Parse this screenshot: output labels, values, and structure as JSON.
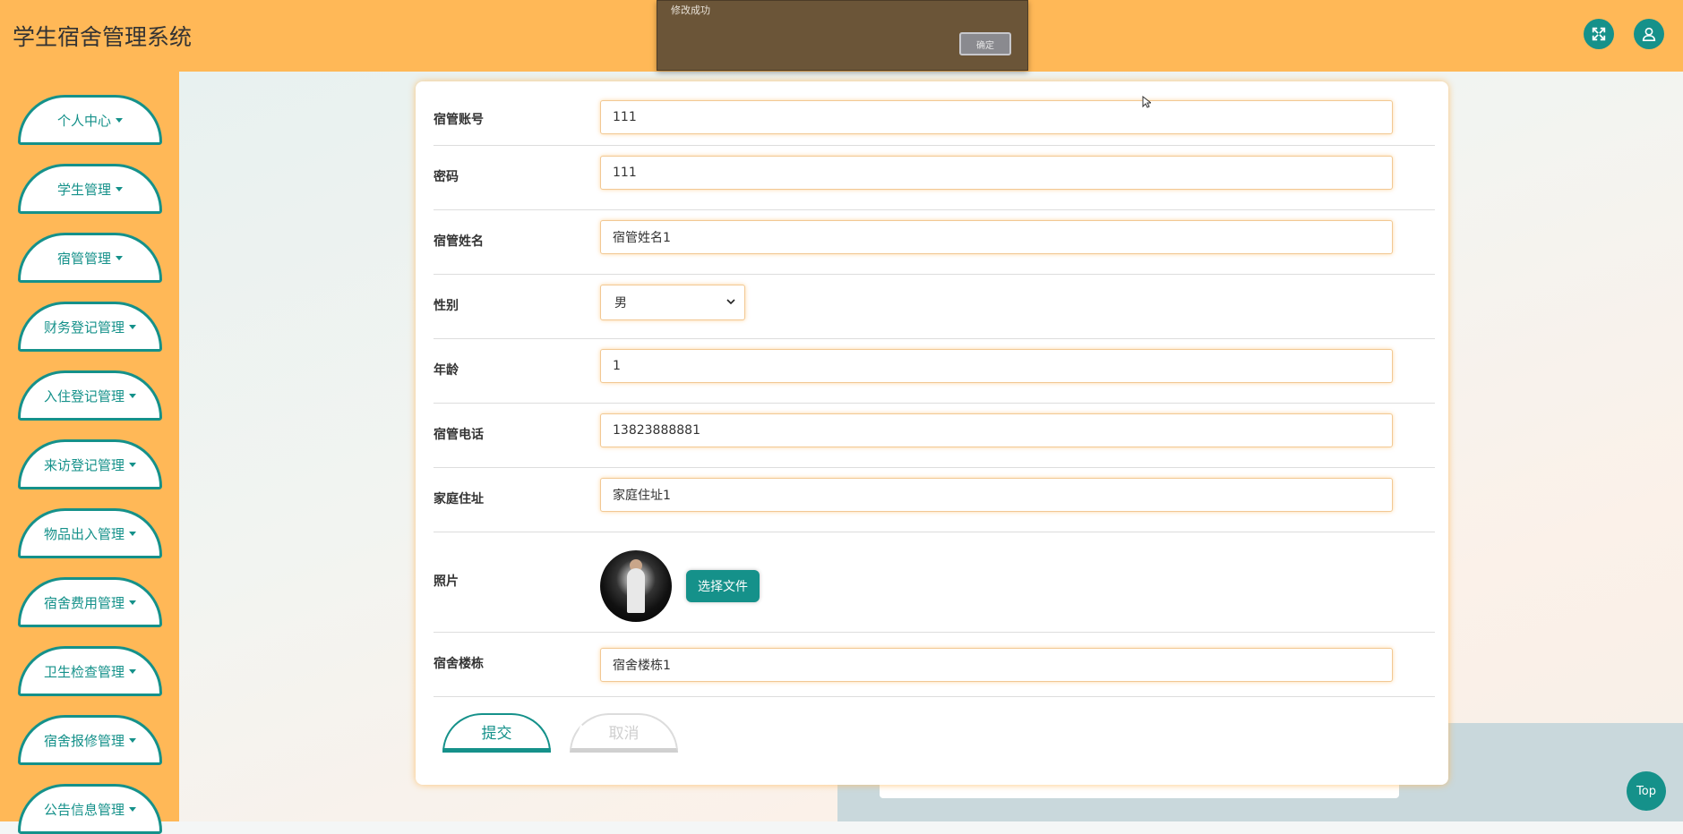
{
  "header": {
    "title": "学生宿舍管理系统",
    "fullscreen_icon": "expand-icon",
    "user_icon": "user-icon",
    "accent": "#ffb857",
    "primary": "#15918a"
  },
  "toast": {
    "message": "修改成功",
    "confirm_label": "确定"
  },
  "sidebar": {
    "items": [
      {
        "label": "个人中心"
      },
      {
        "label": "学生管理"
      },
      {
        "label": "宿管管理"
      },
      {
        "label": "财务登记管理"
      },
      {
        "label": "入住登记管理"
      },
      {
        "label": "来访登记管理"
      },
      {
        "label": "物品出入管理"
      },
      {
        "label": "宿舍费用管理"
      },
      {
        "label": "卫生检查管理"
      },
      {
        "label": "宿舍报修管理"
      },
      {
        "label": "公告信息管理"
      }
    ]
  },
  "form": {
    "fields": {
      "account": {
        "label": "宿管账号",
        "value": "111"
      },
      "password": {
        "label": "密码",
        "value": "111"
      },
      "name": {
        "label": "宿管姓名",
        "value": "宿管姓名1"
      },
      "gender": {
        "label": "性别",
        "value": "男"
      },
      "age": {
        "label": "年龄",
        "value": "1"
      },
      "phone": {
        "label": "宿管电话",
        "value": "13823888881"
      },
      "address": {
        "label": "家庭住址",
        "value": "家庭住址1"
      },
      "photo": {
        "label": "照片",
        "button": "选择文件"
      },
      "building": {
        "label": "宿舍楼栋",
        "value": "宿舍楼栋1"
      }
    },
    "submit_label": "提交",
    "cancel_label": "取消"
  },
  "top_button": "Top"
}
